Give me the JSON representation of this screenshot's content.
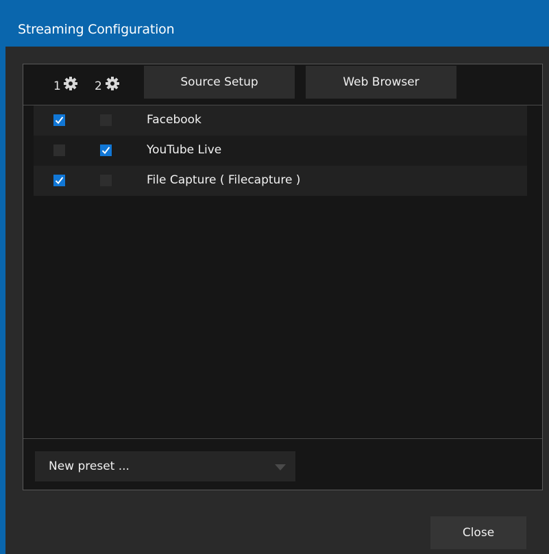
{
  "window": {
    "title": "Streaming Configuration"
  },
  "toolbar": {
    "output1_label": "1",
    "output2_label": "2",
    "source_setup_label": "Source Setup",
    "web_browser_label": "Web Browser",
    "output_icon": "gear-icon"
  },
  "destinations": [
    {
      "label": "Facebook",
      "output1": true,
      "output2": false
    },
    {
      "label": "YouTube Live",
      "output1": false,
      "output2": true
    },
    {
      "label": "File Capture ( Filecapture )",
      "output1": true,
      "output2": false
    }
  ],
  "preset": {
    "value": "New preset ..."
  },
  "footer": {
    "close_label": "Close"
  },
  "colors": {
    "titlebar": "#0a66ad",
    "checkbox_checked": "#1177d6",
    "panel_bg": "#161616",
    "dialog_bg": "#2a2a2a"
  }
}
